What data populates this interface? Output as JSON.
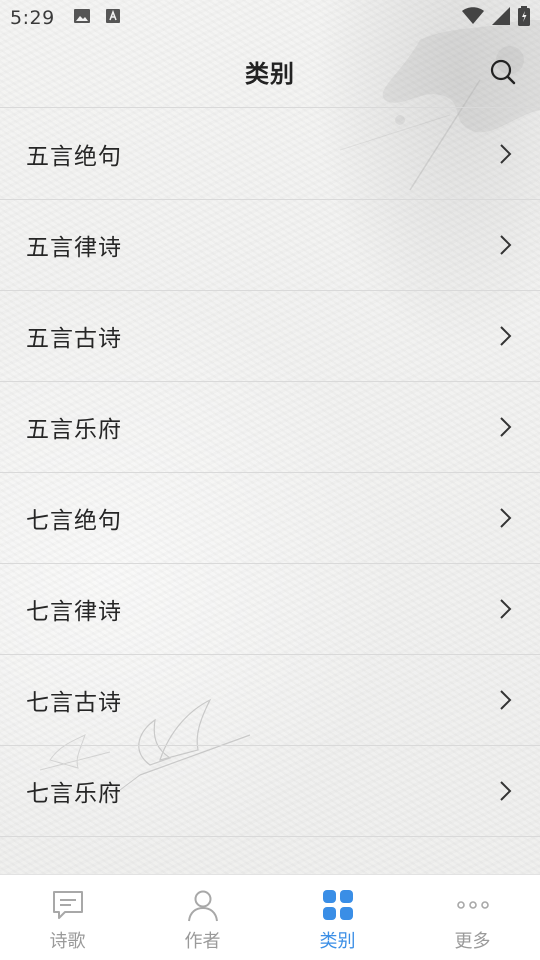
{
  "status_bar": {
    "time": "5:29",
    "icons": [
      "image-icon",
      "font-icon",
      "wifi-icon",
      "signal-icon",
      "battery-icon"
    ]
  },
  "header": {
    "title": "类别",
    "search_icon": "search-icon"
  },
  "categories": [
    {
      "label": "五言绝句"
    },
    {
      "label": "五言律诗"
    },
    {
      "label": "五言古诗"
    },
    {
      "label": "五言乐府"
    },
    {
      "label": "七言绝句"
    },
    {
      "label": "七言律诗"
    },
    {
      "label": "七言古诗"
    },
    {
      "label": "七言乐府"
    }
  ],
  "tab_bar": {
    "tabs": [
      {
        "label": "诗歌",
        "icon": "message-icon",
        "active": false
      },
      {
        "label": "作者",
        "icon": "person-icon",
        "active": false
      },
      {
        "label": "类别",
        "icon": "grid-icon",
        "active": true
      },
      {
        "label": "更多",
        "icon": "more-icon",
        "active": false
      }
    ]
  },
  "colors": {
    "accent": "#3a8ee6",
    "inactive": "#9a9a9a",
    "divider": "#d9d9d9"
  }
}
